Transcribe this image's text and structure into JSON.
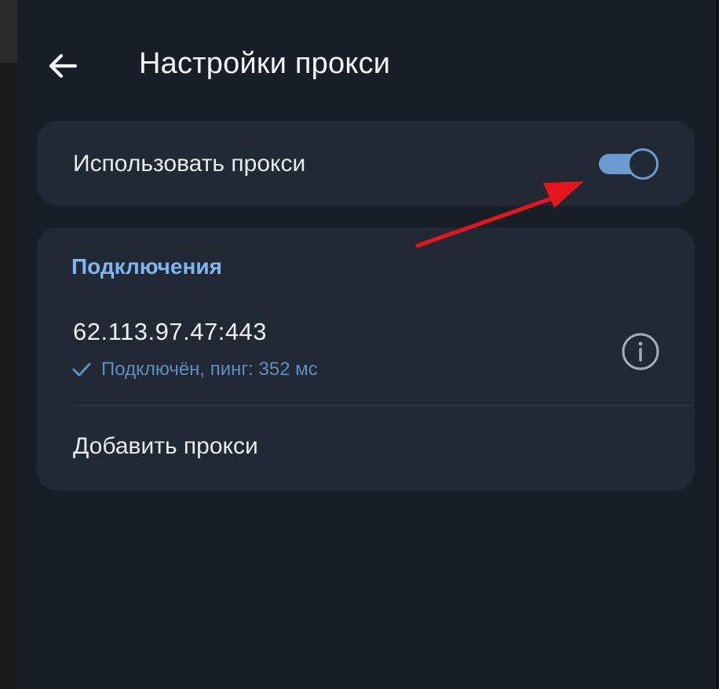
{
  "header": {
    "title": "Настройки прокси",
    "back_icon": "arrow-left-icon"
  },
  "proxy_toggle": {
    "label": "Использовать прокси",
    "enabled": true
  },
  "connections": {
    "section_title": "Подключения",
    "items": [
      {
        "address": "62.113.97.47:443",
        "status": "Подключён, пинг: 352 мс",
        "status_icon": "check-icon",
        "action_icon": "info-icon"
      }
    ],
    "add_label": "Добавить прокси"
  },
  "colors": {
    "background": "#181e27",
    "card": "#212934",
    "accent": "#7fb6ef",
    "toggle_on": "#6b9bd0",
    "annotation": "#e8141b"
  }
}
